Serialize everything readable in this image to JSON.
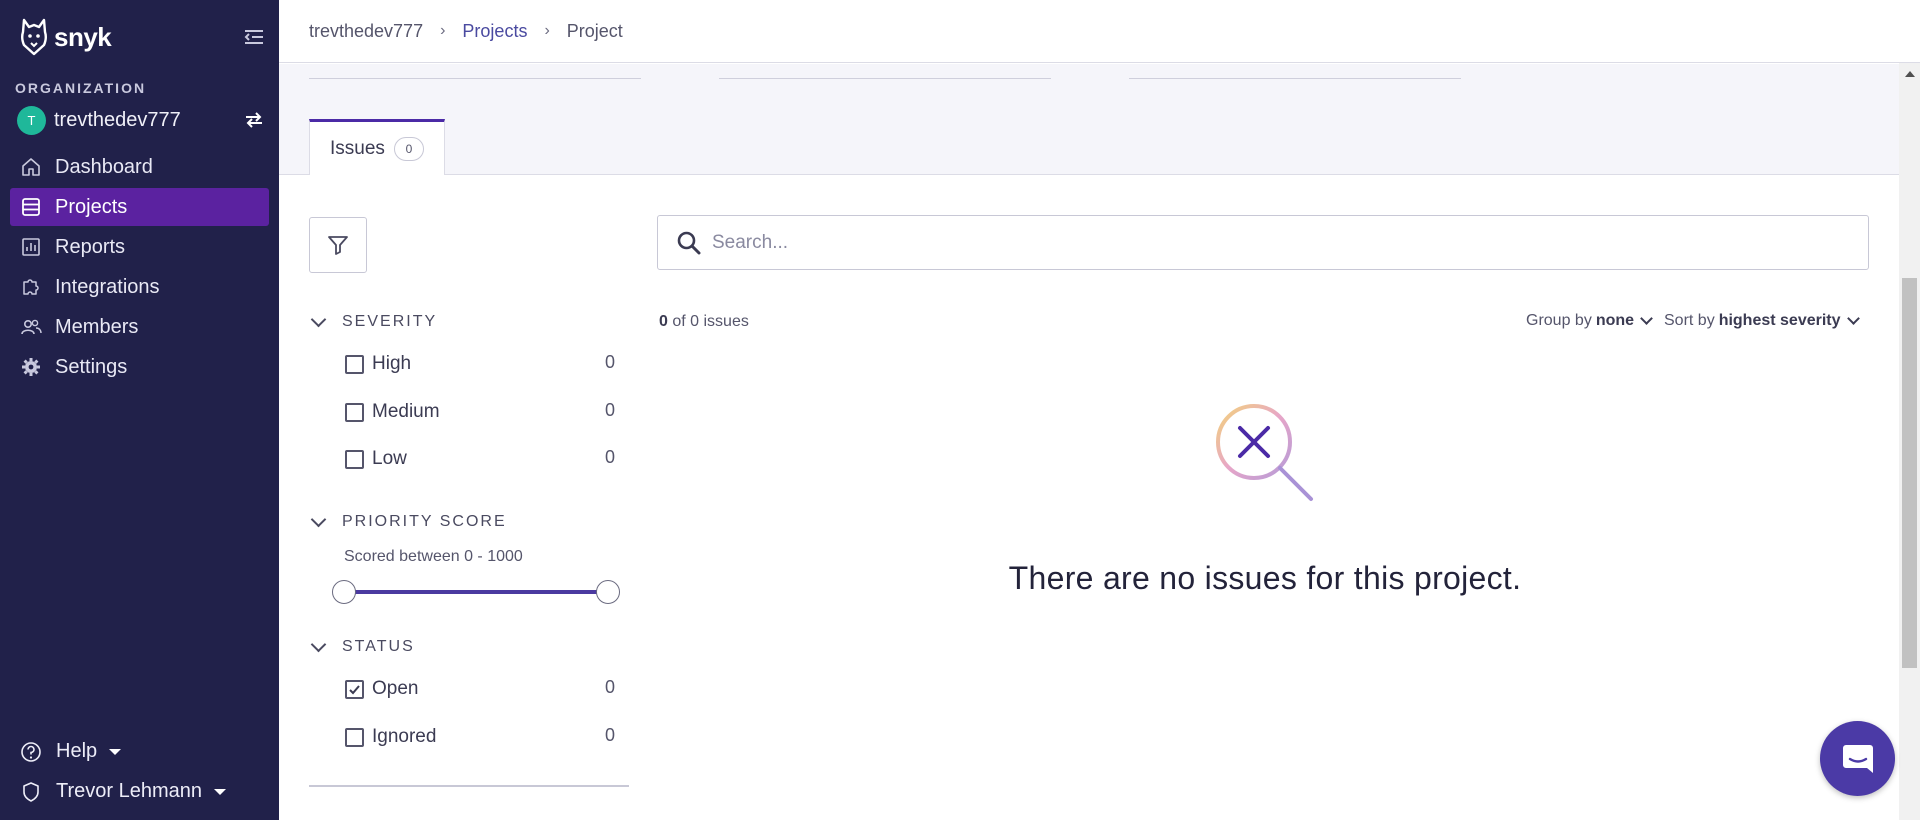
{
  "brand": {
    "name": "snyk"
  },
  "sidebar": {
    "org_label": "ORGANIZATION",
    "org_avatar_letter": "T",
    "org_name": "trevthedev777",
    "nav": [
      {
        "label": "Dashboard",
        "icon": "home-icon",
        "active": false
      },
      {
        "label": "Projects",
        "icon": "layers-icon",
        "active": true
      },
      {
        "label": "Reports",
        "icon": "chart-icon",
        "active": false
      },
      {
        "label": "Integrations",
        "icon": "puzzle-icon",
        "active": false
      },
      {
        "label": "Members",
        "icon": "users-icon",
        "active": false
      },
      {
        "label": "Settings",
        "icon": "gear-icon",
        "active": false
      }
    ],
    "help_label": "Help",
    "user_name": "Trevor Lehmann"
  },
  "breadcrumb": {
    "org": "trevthedev777",
    "projects": "Projects",
    "current": "Project",
    "separator": "›"
  },
  "tabs": [
    {
      "label": "Issues",
      "count": "0"
    }
  ],
  "filters": {
    "severity": {
      "title": "SEVERITY",
      "items": [
        {
          "label": "High",
          "count": "0",
          "checked": false
        },
        {
          "label": "Medium",
          "count": "0",
          "checked": false
        },
        {
          "label": "Low",
          "count": "0",
          "checked": false
        }
      ]
    },
    "priority": {
      "title": "PRIORITY SCORE",
      "range_text": "Scored between 0 - 1000",
      "min": 0,
      "max": 1000
    },
    "status": {
      "title": "STATUS",
      "items": [
        {
          "label": "Open",
          "count": "0",
          "checked": true
        },
        {
          "label": "Ignored",
          "count": "0",
          "checked": false
        }
      ]
    }
  },
  "list": {
    "search_placeholder": "Search...",
    "count_shown": "0",
    "count_text": "of 0 issues",
    "group_by_label": "Group by",
    "group_by_value": "none",
    "sort_by_label": "Sort by",
    "sort_by_value": "highest severity",
    "empty_message": "There are no issues for this project."
  },
  "colors": {
    "sidebar_bg": "#21214a",
    "nav_active": "#5b22a0",
    "accent": "#4b3aa6",
    "avatar": "#1fb89a"
  }
}
